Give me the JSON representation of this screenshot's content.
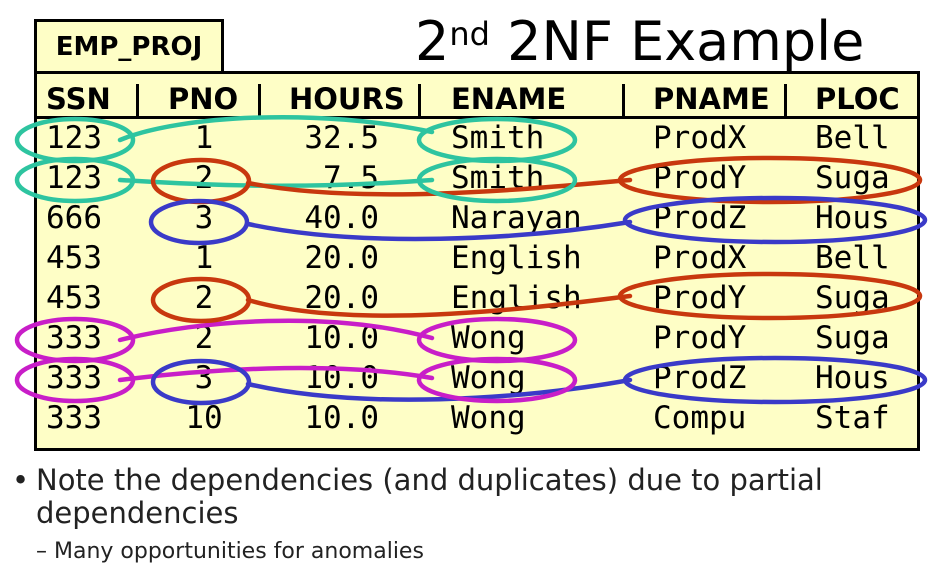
{
  "title": {
    "prefix": "2",
    "superscript": "nd",
    "rest": " 2NF Example"
  },
  "table_name": "EMP_PROJ",
  "columns": [
    "SSN",
    "PNO",
    "HOURS",
    "ENAME",
    "PNAME",
    "PLOC"
  ],
  "rows": [
    [
      "123",
      "1",
      "32.5",
      "Smith",
      "ProdX",
      "Bell"
    ],
    [
      "123",
      "2",
      "7.5",
      "Smith",
      "ProdY",
      "Suga"
    ],
    [
      "666",
      "3",
      "40.0",
      "Narayan",
      "ProdZ",
      "Hous"
    ],
    [
      "453",
      "1",
      "20.0",
      "English",
      "ProdX",
      "Bell"
    ],
    [
      "453",
      "2",
      "20.0",
      "English",
      "ProdY",
      "Suga"
    ],
    [
      "333",
      "2",
      "10.0",
      "Wong",
      "ProdY",
      "Suga"
    ],
    [
      "333",
      "3",
      "10.0",
      "Wong",
      "ProdZ",
      "Hous"
    ],
    [
      "333",
      "10",
      "10.0",
      "Wong",
      "Compu",
      "Staf"
    ]
  ],
  "bullets": {
    "dot": "•",
    "main": "Note the dependencies (and duplicates) due to partial dependencies",
    "sub_dash": "–",
    "sub": "Many opportunities for anomalies"
  },
  "colors": {
    "table_bg": "#fefec6",
    "teal": "#2ec4a0",
    "red": "#c8380e",
    "blue": "#3a3ac8",
    "magenta": "#c81ec8"
  }
}
